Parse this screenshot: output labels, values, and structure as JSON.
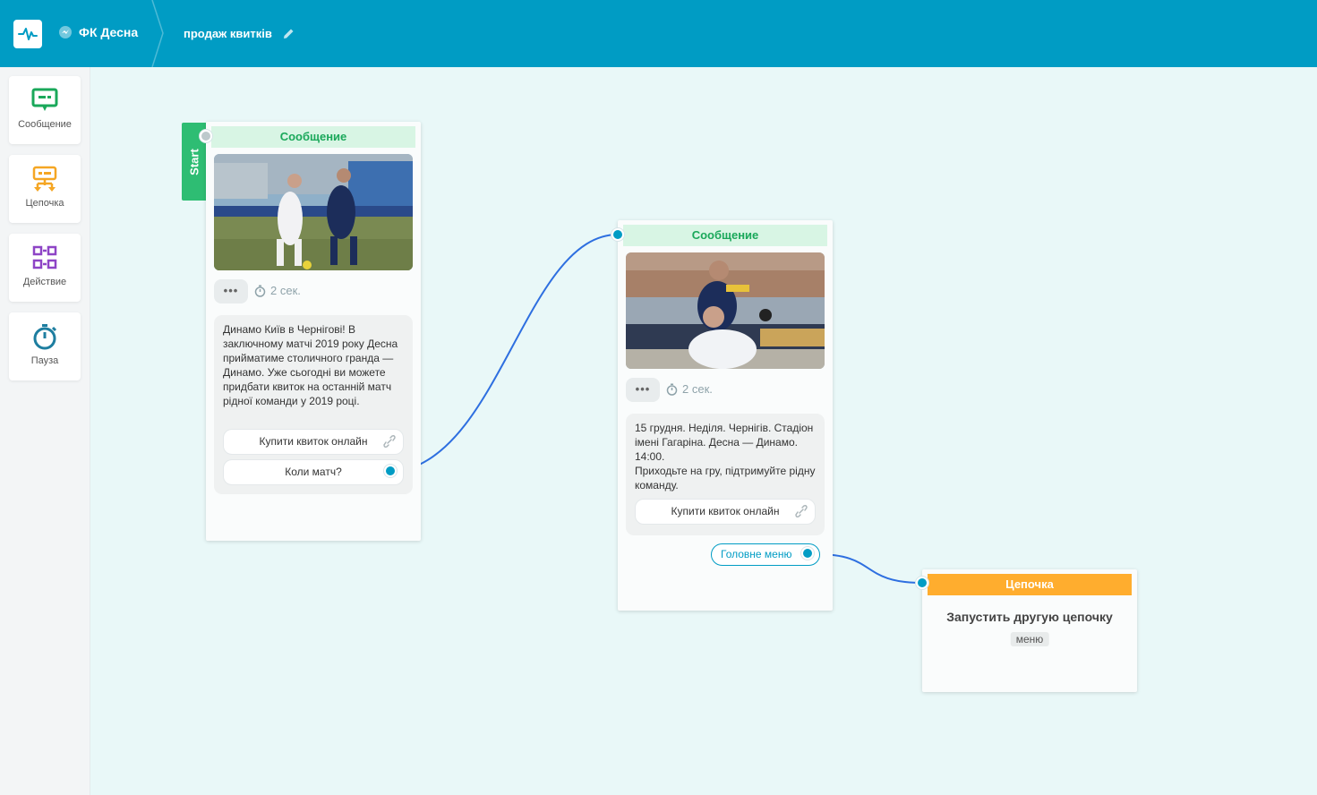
{
  "header": {
    "bot_name": "ФК Десна",
    "flow_title": "продаж квитків"
  },
  "sidebar": {
    "tools": [
      {
        "label": "Сообщение",
        "icon": "message-icon",
        "color": "#1aa85a"
      },
      {
        "label": "Цепочка",
        "icon": "chain-icon",
        "color": "#f5a623"
      },
      {
        "label": "Действие",
        "icon": "action-icon",
        "color": "#8e44c6"
      },
      {
        "label": "Пауза",
        "icon": "timer-icon",
        "color": "#1e7ea0"
      }
    ]
  },
  "nodes": {
    "start_label": "Start",
    "message1": {
      "header": "Сообщение",
      "delay": "2 сек.",
      "text": "Динамо Київ в Чернігові! В заключному матчі 2019 року Десна прийматиме столичного гранда — Динамо. Уже сьогодні ви можете придбати квиток на останній матч рідної команди у 2019 році.",
      "buttons": [
        "Купити квиток онлайн",
        "Коли матч?"
      ]
    },
    "message2": {
      "header": "Сообщение",
      "delay": "2 сек.",
      "text": "15 грудня. Неділя. Чернігів. Стадіон імені Гагаріна. Десна — Динамо. 14:00.\nПриходьте на гру, підтримуйте рідну команду.",
      "buttons": [
        "Купити квиток онлайн"
      ],
      "quick_reply": "Головне меню"
    },
    "chain": {
      "header": "Цепочка",
      "subtitle": "Запустить другую цепочку",
      "tag": "меню"
    }
  },
  "colors": {
    "topbar": "#009cc4",
    "canvas": "#e9f8f8",
    "message_header_bg": "#d8f5e4",
    "message_header_text": "#1aa85a",
    "chain_header": "#ffad2e",
    "start": "#2ebd73",
    "wire": "#2e6fe0"
  }
}
